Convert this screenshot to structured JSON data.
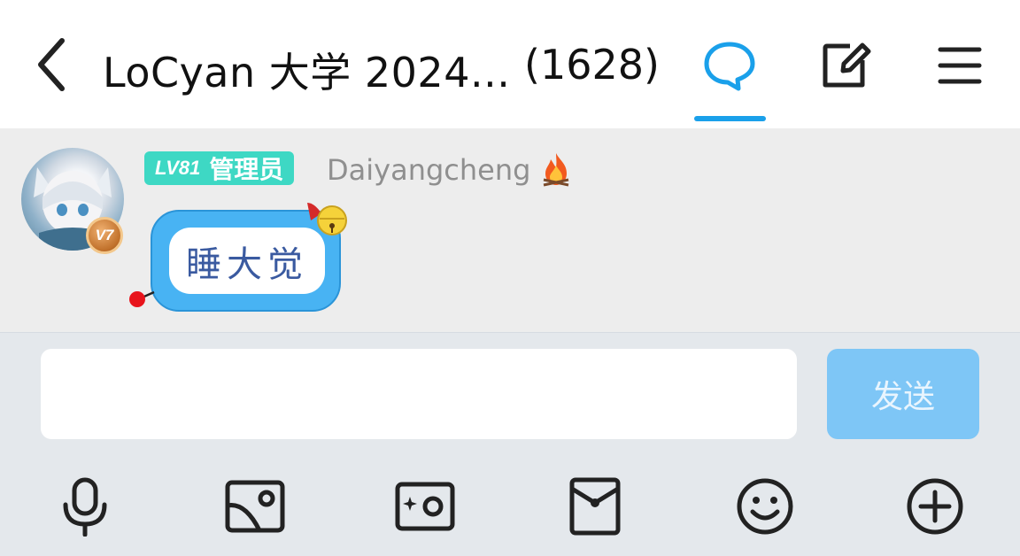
{
  "header": {
    "title": "LoCyan 大学 2024...",
    "member_count": "(1628)"
  },
  "message": {
    "level_badge": "LV81",
    "role_badge": "管理员",
    "sender": "Daiyangcheng",
    "vip_level": "V7",
    "text": "睡大觉"
  },
  "composer": {
    "input_value": "",
    "send_label": "发送"
  },
  "colors": {
    "accent": "#1aa0ea",
    "badge": "#3ed8c4",
    "bubble": "#48b3f3",
    "send_disabled": "#7ec6f6"
  },
  "icons": [
    "back-icon",
    "chat-icon",
    "edit-icon",
    "menu-icon",
    "microphone-icon",
    "image-icon",
    "camera-icon",
    "red-packet-icon",
    "emoji-icon",
    "plus-icon"
  ]
}
